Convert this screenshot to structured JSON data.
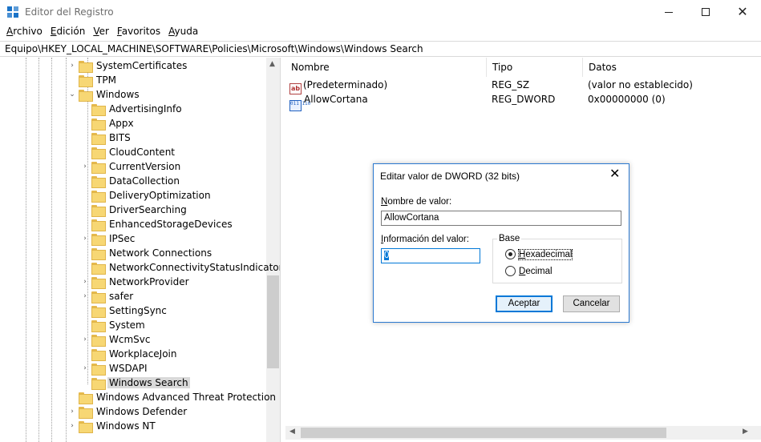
{
  "window": {
    "title": "Editor del Registro",
    "close_glyph": "✕"
  },
  "menu": {
    "items": [
      {
        "hotkey": "A",
        "rest": "rchivo"
      },
      {
        "hotkey": "E",
        "rest": "dición"
      },
      {
        "hotkey": "V",
        "rest": "er"
      },
      {
        "hotkey": "F",
        "rest": "avoritos"
      },
      {
        "hotkey": "A",
        "rest": "yuda"
      }
    ]
  },
  "address": {
    "path": "Equipo\\HKEY_LOCAL_MACHINE\\SOFTWARE\\Policies\\Microsoft\\Windows\\Windows Search"
  },
  "tree": {
    "items": [
      {
        "label": "SystemCertificates",
        "expander": "›",
        "level": 0
      },
      {
        "label": "TPM",
        "expander": "",
        "level": 0
      },
      {
        "label": "Windows",
        "expander": "⌄",
        "level": 0
      },
      {
        "label": "AdvertisingInfo",
        "expander": "",
        "level": 1
      },
      {
        "label": "Appx",
        "expander": "",
        "level": 1
      },
      {
        "label": "BITS",
        "expander": "",
        "level": 1
      },
      {
        "label": "CloudContent",
        "expander": "",
        "level": 1
      },
      {
        "label": "CurrentVersion",
        "expander": "›",
        "level": 1
      },
      {
        "label": "DataCollection",
        "expander": "",
        "level": 1
      },
      {
        "label": "DeliveryOptimization",
        "expander": "",
        "level": 1
      },
      {
        "label": "DriverSearching",
        "expander": "",
        "level": 1
      },
      {
        "label": "EnhancedStorageDevices",
        "expander": "",
        "level": 1
      },
      {
        "label": "IPSec",
        "expander": "›",
        "level": 1
      },
      {
        "label": "Network Connections",
        "expander": "",
        "level": 1
      },
      {
        "label": "NetworkConnectivityStatusIndicator",
        "expander": "",
        "level": 1
      },
      {
        "label": "NetworkProvider",
        "expander": "›",
        "level": 1
      },
      {
        "label": "safer",
        "expander": "›",
        "level": 1
      },
      {
        "label": "SettingSync",
        "expander": "",
        "level": 1
      },
      {
        "label": "System",
        "expander": "",
        "level": 1
      },
      {
        "label": "WcmSvc",
        "expander": "›",
        "level": 1
      },
      {
        "label": "WorkplaceJoin",
        "expander": "",
        "level": 1
      },
      {
        "label": "WSDAPI",
        "expander": "›",
        "level": 1
      },
      {
        "label": "Windows Search",
        "expander": "",
        "level": 1,
        "selected": true
      },
      {
        "label": "Windows Advanced Threat Protection",
        "expander": "",
        "level": 0
      },
      {
        "label": "Windows Defender",
        "expander": "›",
        "level": 0
      },
      {
        "label": "Windows NT",
        "expander": "›",
        "level": 0
      }
    ],
    "scroll_up_glyph": "▲"
  },
  "values": {
    "columns": {
      "name": "Nombre",
      "type": "Tipo",
      "data": "Datos"
    },
    "rows": [
      {
        "icon": "string-value-icon",
        "icon_text": "ab",
        "name": "(Predeterminado)",
        "type": "REG_SZ",
        "data": "(valor no establecido)"
      },
      {
        "icon": "dword-value-icon",
        "icon_text": "011\n110",
        "name": "AllowCortana",
        "type": "REG_DWORD",
        "data": "0x00000000 (0)"
      }
    ],
    "hscroll": {
      "left_glyph": "◀",
      "right_glyph": "▶"
    }
  },
  "dialog": {
    "title": "Editar valor de DWORD (32 bits)",
    "close_glyph": "✕",
    "name_label_hotkey": "N",
    "name_label_rest": "ombre de valor:",
    "name_value": "AllowCortana",
    "data_label_hotkey": "I",
    "data_label_rest": "nformación del valor:",
    "data_value": "0",
    "base_label": "Base",
    "hex_hotkey": "H",
    "hex_rest": "exadecimal",
    "dec_hotkey": "D",
    "dec_rest": "ecimal",
    "base_selected": "Hexadecimal",
    "ok_label": "Aceptar",
    "cancel_label": "Cancelar"
  }
}
